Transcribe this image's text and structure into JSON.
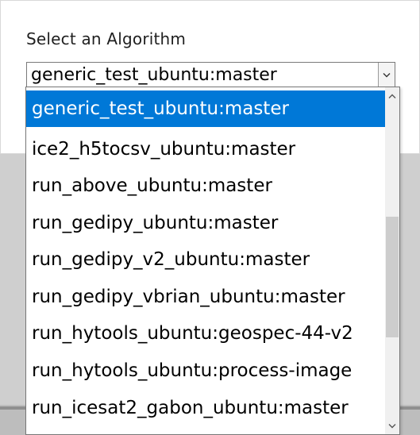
{
  "dialog": {
    "title": "Select an Algorithm"
  },
  "select": {
    "value": "generic_test_ubuntu:master",
    "icon": "chevron-down-icon"
  },
  "dropdown": {
    "options": [
      {
        "label": "generic_test_ubuntu:master",
        "selected": true
      },
      {
        "label": "ice2_h5tocsv_ubuntu:master",
        "selected": false
      },
      {
        "label": "run_above_ubuntu:master",
        "selected": false
      },
      {
        "label": "run_gedipy_ubuntu:master",
        "selected": false
      },
      {
        "label": "run_gedipy_v2_ubuntu:master",
        "selected": false
      },
      {
        "label": "run_gedipy_vbrian_ubuntu:master",
        "selected": false
      },
      {
        "label": "run_hytools_ubuntu:geospec-44-v2",
        "selected": false
      },
      {
        "label": "run_hytools_ubuntu:process-image",
        "selected": false
      },
      {
        "label": "run_icesat2_gabon_ubuntu:master",
        "selected": false
      }
    ]
  },
  "colors": {
    "selection": "#0078d7",
    "scrollbar_track": "#f0f0f0",
    "scrollbar_thumb": "#cdcdcd"
  }
}
